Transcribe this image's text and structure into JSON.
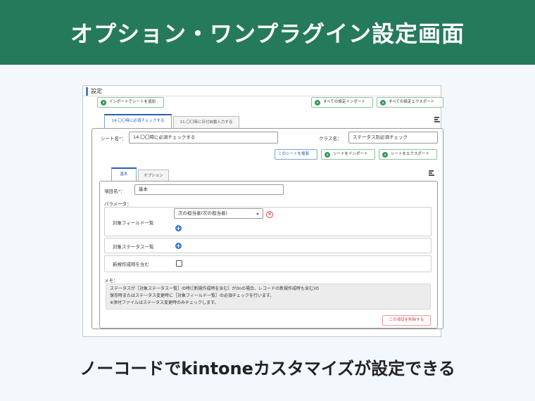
{
  "banner": {
    "title": "オプション・ワンプラグイン設定画面"
  },
  "frame": {
    "header": "設定"
  },
  "toolbar": {
    "add_sheet": "インポートでシートを追加",
    "import_all": "すべての設定インポート",
    "export_all": "すべての設定エクスポート"
  },
  "sheet_tabs": [
    "14.〇〇時に必須チェックする",
    "11.〇〇時に日付自動入力する"
  ],
  "sheet": {
    "name_label": "シート名",
    "name_value": "14.〇〇時に必須チェックする",
    "class_label": "クラス名：",
    "class_value": "ステータス別必須チェック",
    "copy_button": "このシートを複製",
    "import_button": "シートをインポート",
    "export_button": "シートをエクスポート"
  },
  "inner_tabs": [
    "基本",
    "オプション"
  ],
  "item": {
    "name_label": "項目名",
    "name_value": "基本",
    "params_label": "パラメータ："
  },
  "params": {
    "field_list_label": "対象フィールド一覧",
    "field_select_value": "次の担当者(次の担当者)",
    "status_list_label": "対象ステータス一覧",
    "include_new_label": "新規作成時を含む"
  },
  "memo": {
    "label": "メモ：",
    "lines": [
      "ステータスが［対象ステータス一覧］の時(［新規作成時を含む］が0nの場合、レコードの新規作成時も含む)の",
      "保存時またはステータス変更時に［対象フィールド一覧］の必須チェックを行います。",
      "※添付ファイルはステータス変更時のみチェックします。"
    ]
  },
  "delete_button": "この項目を削除する",
  "tagline": "ノーコードでkintoneカスタマイズが設定できる",
  "colors": {
    "banner": "#267a5c",
    "accent_blue": "#2a5db0",
    "danger": "#e04545"
  }
}
